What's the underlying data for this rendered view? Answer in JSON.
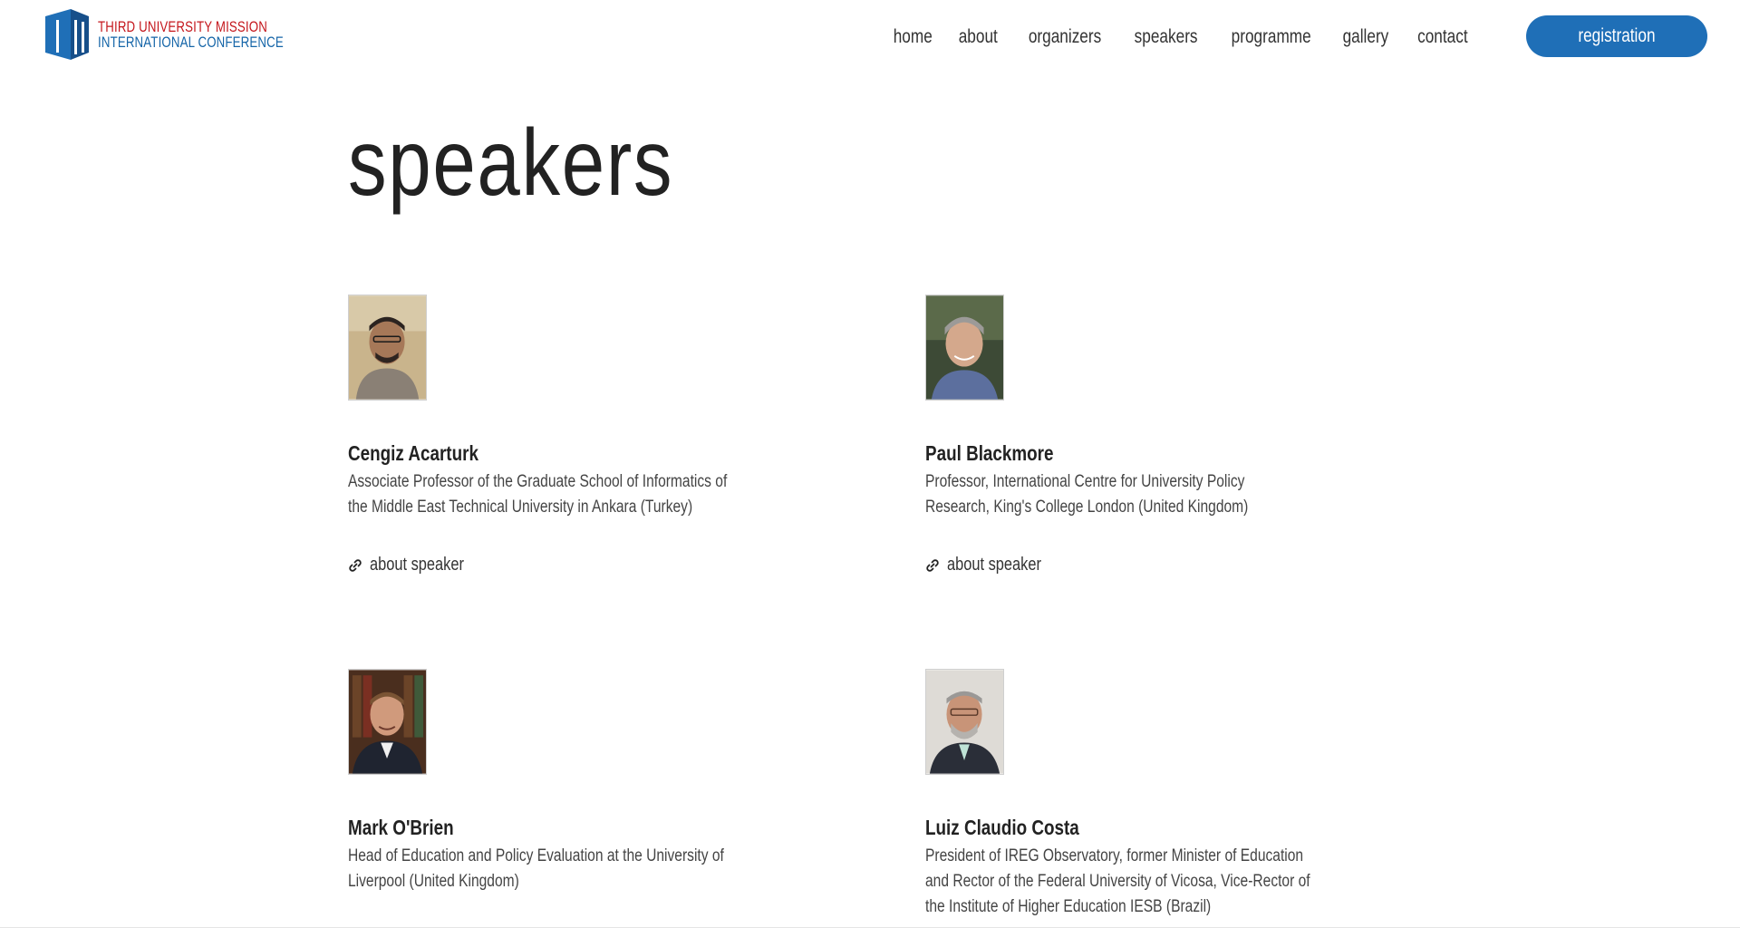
{
  "logo": {
    "line1": "THIRD  UNIVERSITY MISSION",
    "line2": "INTERNATIONAL CONFERENCE",
    "colors": {
      "red": "#c4161c",
      "blue": "#1565a8"
    }
  },
  "nav": {
    "items": [
      {
        "label": "home"
      },
      {
        "label": "about"
      },
      {
        "label": "organizers"
      },
      {
        "label": "speakers",
        "active": true
      },
      {
        "label": "programme"
      },
      {
        "label": "gallery"
      },
      {
        "label": "contact"
      }
    ],
    "active_underline_color": "#f0a0ac"
  },
  "registration_button": {
    "label": "registration",
    "color": "#1f6fb7"
  },
  "page_title": "speakers",
  "speakers": [
    {
      "name": "Cengiz Acarturk",
      "description": "Associate Professor of the Graduate School of Informatics of the Middle East Technical University in Ankara (Turkey)",
      "link_label": "about speaker",
      "photo_icon": "portrait-photo"
    },
    {
      "name": "Paul Blackmore",
      "description": "Professor, International Centre for University Policy Research, King's College London (United Kingdom)",
      "link_label": "about speaker",
      "photo_icon": "portrait-photo"
    },
    {
      "name": "Mark O'Brien",
      "description": "Head of Education and Policy Evaluation at the University of Liverpool (United Kingdom)",
      "photo_icon": "portrait-photo"
    },
    {
      "name": "Luiz Claudio Costa",
      "description": "President of IREG Observatory, former Minister of Education and Rector of the Federal University of Vicosa, Vice-Rector of the Institute of Higher Education IESB (Brazil)",
      "photo_icon": "portrait-photo"
    }
  ],
  "icons": {
    "link": "link-icon",
    "logo": "building-logo-icon"
  }
}
